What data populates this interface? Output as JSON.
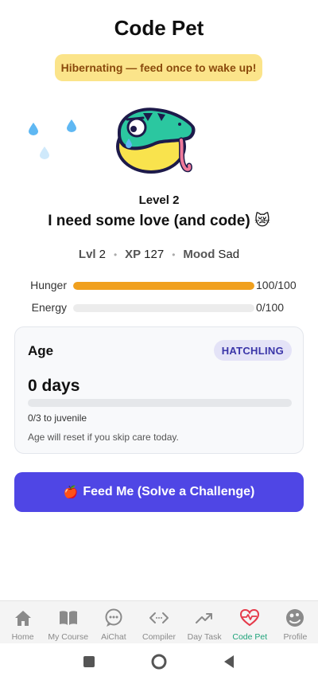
{
  "header": {
    "title": "Code Pet"
  },
  "banner": {
    "text": "Hibernating — feed once to wake up!"
  },
  "pet": {
    "icon": "sleeping-snake-mascot-icon",
    "level_label": "Level 2",
    "mood_message": "I need some love (and code) 😿"
  },
  "stats": {
    "level_key": "Lvl",
    "level_value": "2",
    "xp_key": "XP",
    "xp_value": "127",
    "mood_key": "Mood",
    "mood_value": "Sad"
  },
  "bars": {
    "hunger": {
      "label": "Hunger",
      "value_text": "100/100",
      "fraction": 1.0,
      "color": "#f0a01e"
    },
    "energy": {
      "label": "Energy",
      "value_text": "0/100",
      "fraction": 0.0,
      "color": "#f0a01e"
    }
  },
  "age_card": {
    "heading": "Age",
    "badge": "HATCHLING",
    "days": "0 days",
    "progress_text": "0/3 to juvenile",
    "progress_fraction": 0.0,
    "note": "Age will reset if you skip care today."
  },
  "feed_button": {
    "icon": "🍎",
    "label": "Feed Me (Solve a Challenge)"
  },
  "nav": {
    "items": [
      {
        "label": "Home",
        "icon": "home-icon"
      },
      {
        "label": "My Course",
        "icon": "book-icon"
      },
      {
        "label": "AiChat",
        "icon": "chat-icon"
      },
      {
        "label": "Compiler",
        "icon": "code-icon"
      },
      {
        "label": "Day Task",
        "icon": "trend-icon"
      },
      {
        "label": "Code Pet",
        "icon": "heart-pulse-icon",
        "active": true
      },
      {
        "label": "Profile",
        "icon": "profile-icon"
      }
    ]
  },
  "colors": {
    "accent": "#4f46e5",
    "banner_bg": "#fbe48a",
    "banner_text": "#8a4a0c",
    "nav_active": "#1fa37a",
    "hunger": "#f0a01e"
  }
}
